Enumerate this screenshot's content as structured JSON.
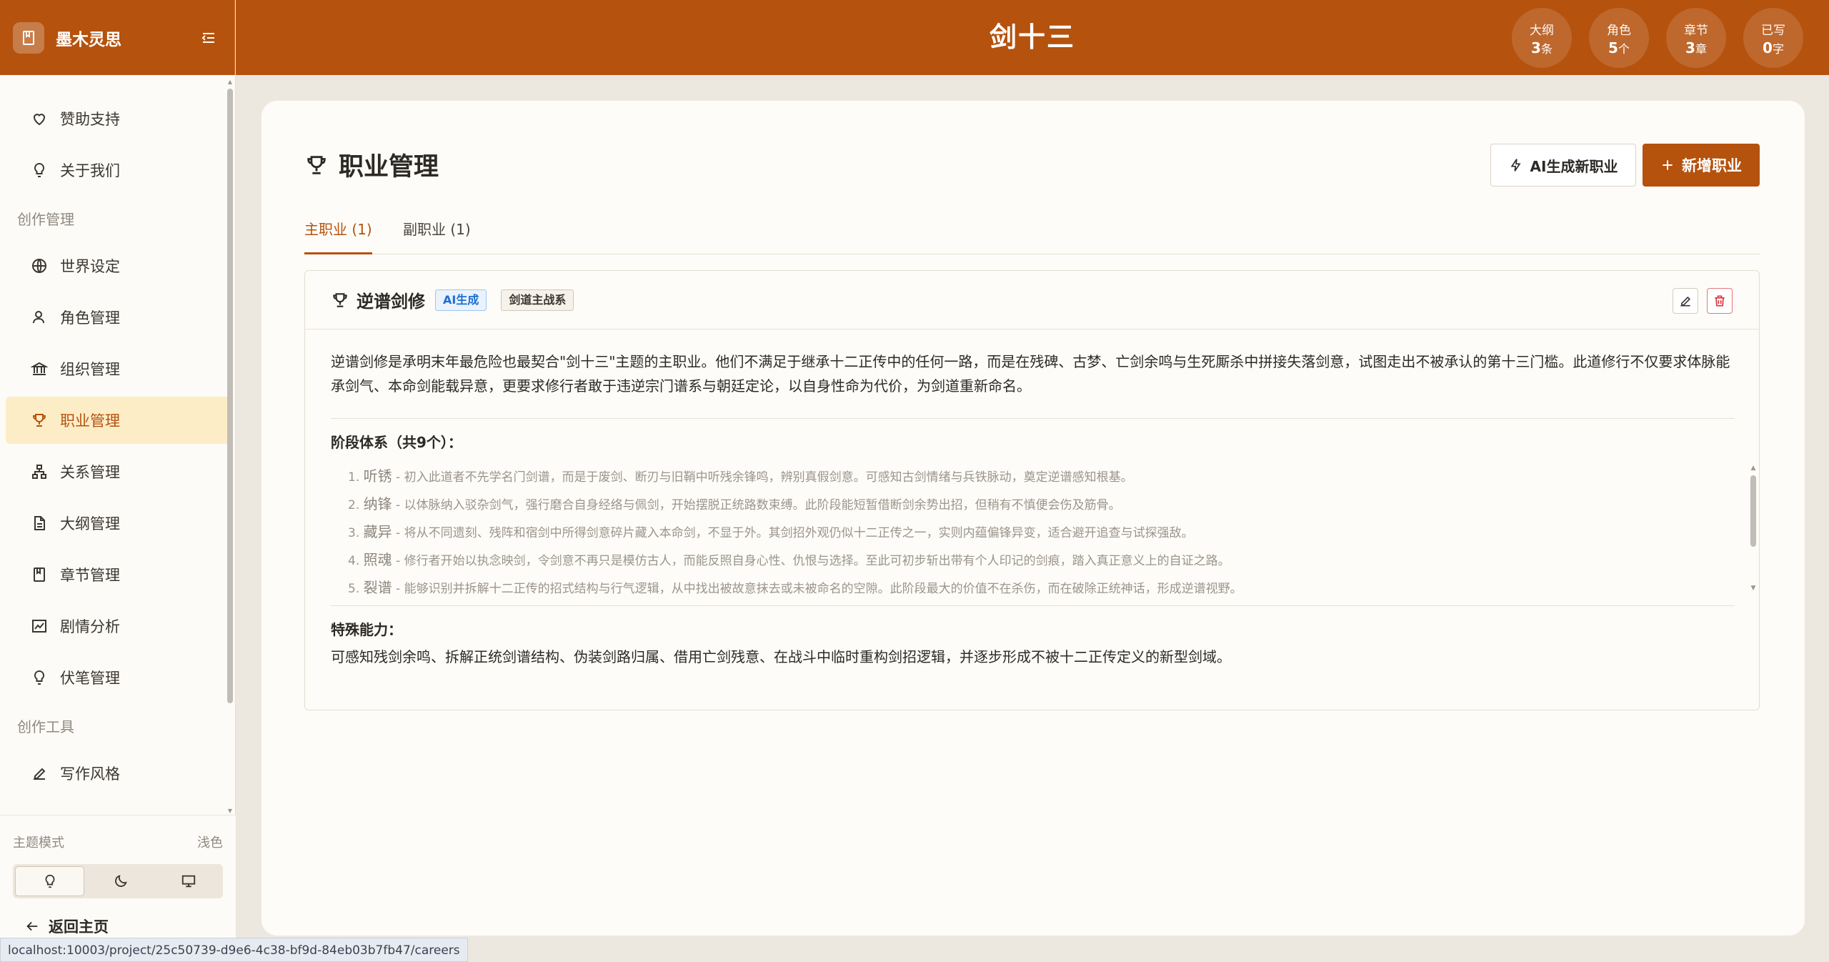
{
  "app": {
    "name": "墨木灵思",
    "project_title": "剑十三"
  },
  "stats": [
    {
      "label": "大纲",
      "value": "3",
      "unit": "条"
    },
    {
      "label": "角色",
      "value": "5",
      "unit": "个"
    },
    {
      "label": "章节",
      "value": "3",
      "unit": "章"
    },
    {
      "label": "已写",
      "value": "0",
      "unit": "字"
    }
  ],
  "sidebar": {
    "items": [
      {
        "label": "赞助支持",
        "icon": "heart-icon"
      },
      {
        "label": "关于我们",
        "icon": "lightbulb-icon"
      }
    ],
    "group_create": "创作管理",
    "create_items": [
      {
        "label": "世界设定",
        "icon": "globe-icon"
      },
      {
        "label": "角色管理",
        "icon": "user-icon"
      },
      {
        "label": "组织管理",
        "icon": "bank-icon"
      },
      {
        "label": "职业管理",
        "icon": "trophy-icon"
      },
      {
        "label": "关系管理",
        "icon": "sitemap-icon"
      },
      {
        "label": "大纲管理",
        "icon": "document-icon"
      },
      {
        "label": "章节管理",
        "icon": "book-icon"
      },
      {
        "label": "剧情分析",
        "icon": "chart-icon"
      },
      {
        "label": "伏笔管理",
        "icon": "lightbulb-icon"
      }
    ],
    "group_tools": "创作工具",
    "tool_items": [
      {
        "label": "写作风格",
        "icon": "edit-icon"
      }
    ],
    "theme_label": "主题模式",
    "theme_value": "浅色",
    "back_home": "返回主页"
  },
  "page": {
    "title": "职业管理",
    "ai_button": "AI生成新职业",
    "add_button": "新增职业",
    "tabs": [
      {
        "label": "主职业 (1)",
        "active": true
      },
      {
        "label": "副职业 (1)",
        "active": false
      }
    ]
  },
  "career": {
    "name": "逆谱剑修",
    "tag_ai": "AI生成",
    "tag_type": "剑道主战系",
    "description": "逆谱剑修是承明末年最危险也最契合\"剑十三\"主题的主职业。他们不满足于继承十二正传中的任何一路，而是在残碑、古梦、亡剑余鸣与生死厮杀中拼接失落剑意，试图走出不被承认的第十三门槛。此道修行不仅要求体脉能承剑气、本命剑能载异意，更要求修行者敢于违逆宗门谱系与朝廷定论，以自身性命为代价，为剑道重新命名。",
    "stages_title": "阶段体系（共9个）：",
    "stages": [
      {
        "no": "1.",
        "name": "听锈",
        "desc": " - 初入此道者不先学名门剑谱，而是于废剑、断刃与旧鞘中听残余锋鸣，辨别真假剑意。可感知古剑情绪与兵铁脉动，奠定逆谱感知根基。"
      },
      {
        "no": "2.",
        "name": "纳锋",
        "desc": " - 以体脉纳入驳杂剑气，强行磨合自身经络与佩剑，开始摆脱正统路数束缚。此阶段能短暂借断剑余势出招，但稍有不慎便会伤及筋骨。"
      },
      {
        "no": "3.",
        "name": "藏异",
        "desc": " - 将从不同遗刻、残阵和宿剑中所得剑意碎片藏入本命剑，不显于外。其剑招外观仍似十二正传之一，实则内蕴偏锋异变，适合避开追查与试探强敌。"
      },
      {
        "no": "4.",
        "name": "照魂",
        "desc": " - 修行者开始以执念映剑，令剑意不再只是模仿古人，而能反照自身心性、仇恨与选择。至此可初步斩出带有个人印记的剑痕，踏入真正意义上的自证之路。"
      },
      {
        "no": "5.",
        "name": "裂谱",
        "desc": " - 能够识别并拆解十二正传的招式结构与行气逻辑，从中找出被故意抹去或未被命名的空隙。此阶段最大的价值不在杀伤，而在破除正统神话，形成逆谱视野。"
      }
    ],
    "ability_title": "特殊能力：",
    "ability": "可感知残剑余鸣、拆解正统剑谱结构、伪装剑路归属、借用亡剑残意、在战斗中临时重构剑招逻辑，并逐步形成不被十二正传定义的新型剑域。"
  },
  "status_url": "localhost:10003/project/25c50739-d9e6-4c38-bf9d-84eb03b7fb47/careers",
  "colors": {
    "brand": "#b5520e",
    "active_bg": "#fdedc7",
    "tag_ai": "#1d6fd1",
    "danger": "#e0787a"
  }
}
